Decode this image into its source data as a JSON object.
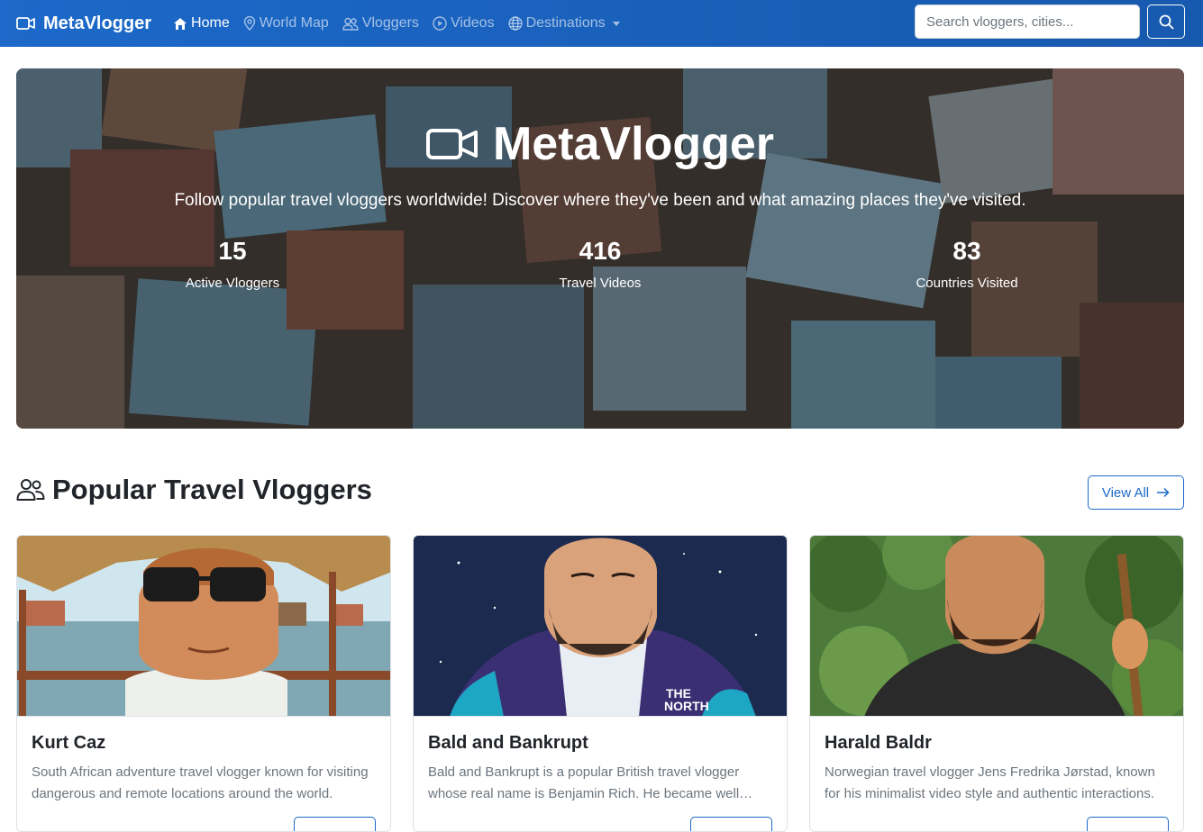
{
  "navbar": {
    "brand": "MetaVlogger",
    "links": [
      {
        "label": "Home",
        "icon": "house-icon",
        "active": true
      },
      {
        "label": "World Map",
        "icon": "map-pin-icon"
      },
      {
        "label": "Vloggers",
        "icon": "people-icon"
      },
      {
        "label": "Videos",
        "icon": "play-circle-icon"
      },
      {
        "label": "Destinations",
        "icon": "globe-icon"
      }
    ],
    "search_placeholder": "Search vloggers, cities..."
  },
  "hero": {
    "title": "MetaVlogger",
    "subtitle": "Follow popular travel vloggers worldwide! Discover where they've been and what amazing places they've visited.",
    "stats": [
      {
        "value": "15",
        "label": "Active Vloggers"
      },
      {
        "value": "416",
        "label": "Travel Videos"
      },
      {
        "value": "83",
        "label": "Countries Visited"
      }
    ]
  },
  "section": {
    "title": "Popular Travel Vloggers",
    "view_all": "View All"
  },
  "vloggers": [
    {
      "name": "Kurt Caz",
      "description": "South African adventure travel vlogger known for visiting dangerous and remote locations around the world."
    },
    {
      "name": "Bald and Bankrupt",
      "description": "Bald and Bankrupt is a popular British travel vlogger whose real name is Benjamin Rich. He became well known."
    },
    {
      "name": "Harald Baldr",
      "description": "Norwegian travel vlogger Jens Fredrika Jørstad, known for his minimalist video style and authentic interactions."
    }
  ],
  "colors": {
    "primary": "#1c69c9",
    "navbar": "#1c69c9"
  }
}
